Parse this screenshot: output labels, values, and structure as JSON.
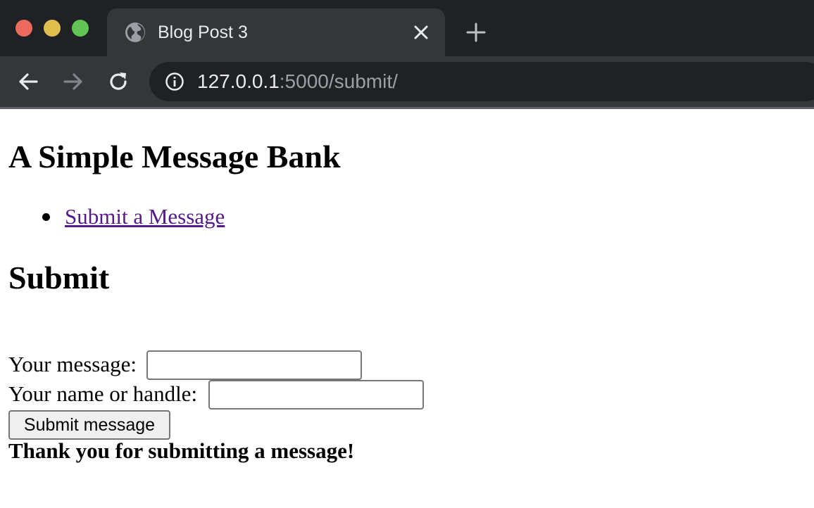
{
  "browser": {
    "tab_title": "Blog Post 3",
    "address_host": "127.0.0.1",
    "address_rest": ":5000/submit/"
  },
  "page": {
    "title": "A Simple Message Bank",
    "nav_links": [
      "Submit a Message"
    ],
    "section_title": "Submit",
    "form": {
      "message_label": "Your message:",
      "message_value": "",
      "name_label": "Your name or handle:",
      "name_value": "",
      "submit_label": "Submit message"
    },
    "confirmation": "Thank you for submitting a message!"
  }
}
